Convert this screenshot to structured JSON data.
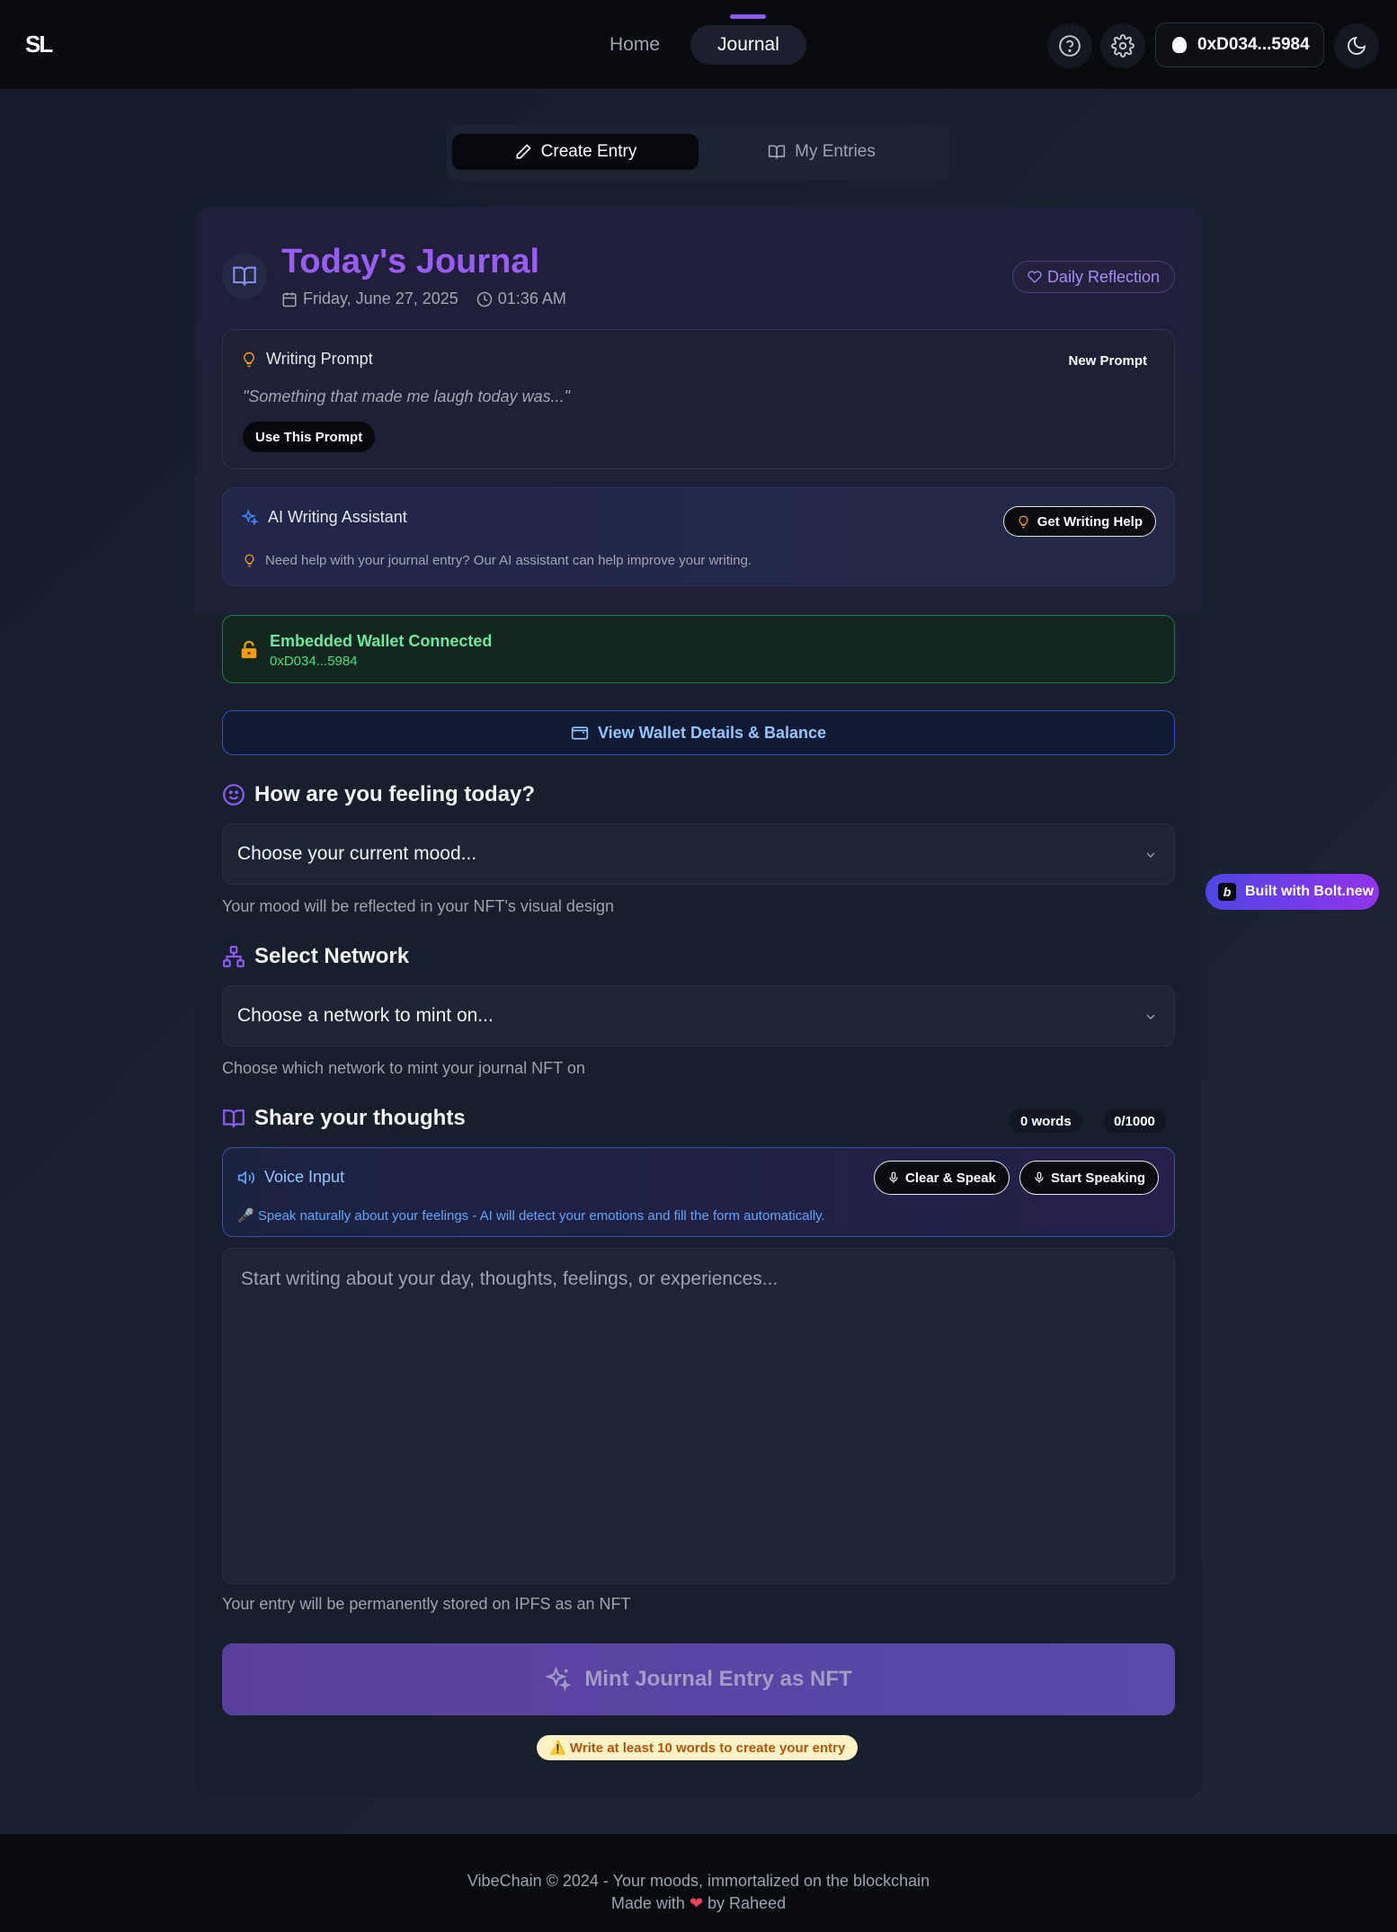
{
  "header": {
    "logo": "SL",
    "nav": [
      {
        "label": "Home"
      },
      {
        "label": "Journal"
      }
    ],
    "wallet_address": "0xD034...5984"
  },
  "tabs": [
    {
      "label": "Create Entry"
    },
    {
      "label": "My Entries"
    }
  ],
  "journal": {
    "title": "Today's Journal",
    "date": "Friday, June 27, 2025",
    "time": "01:36 AM",
    "badge": "Daily Reflection"
  },
  "prompt": {
    "title": "Writing Prompt",
    "new_label": "New Prompt",
    "text": "\"Something that made me laugh today was...\"",
    "use_label": "Use This Prompt"
  },
  "ai": {
    "title": "AI Writing Assistant",
    "button": "Get Writing Help",
    "description": "Need help with your journal entry? Our AI assistant can help improve your writing."
  },
  "embedded_wallet": {
    "title": "Embedded Wallet Connected",
    "address": "0xD034...5984"
  },
  "view_wallet_label": "View Wallet Details & Balance",
  "mood": {
    "title": "How are you feeling today?",
    "placeholder": "Choose your current mood...",
    "hint": "Your mood will be reflected in your NFT's visual design"
  },
  "network": {
    "title": "Select Network",
    "placeholder": "Choose a network to mint on...",
    "hint": "Choose which network to mint your journal NFT on"
  },
  "thoughts": {
    "title": "Share your thoughts",
    "word_count": "0 words",
    "char_count": "0/1000"
  },
  "voice": {
    "title": "Voice Input",
    "clear_label": "Clear & Speak",
    "start_label": "Start Speaking",
    "description": "🎤 Speak naturally about your feelings - AI will detect your emotions and fill the form automatically."
  },
  "entry": {
    "placeholder": "Start writing about your day, thoughts, feelings, or experiences...",
    "hint": "Your entry will be permanently stored on IPFS as an NFT"
  },
  "mint_label": "Mint Journal Entry as NFT",
  "warning": "⚠️ Write at least 10 words to create your entry",
  "bolt_label": "Built with Bolt.new",
  "footer": {
    "line1": "VibeChain © 2024 - Your moods, immortalized on the blockchain",
    "made_with": "Made with",
    "by": "by Raheed"
  }
}
